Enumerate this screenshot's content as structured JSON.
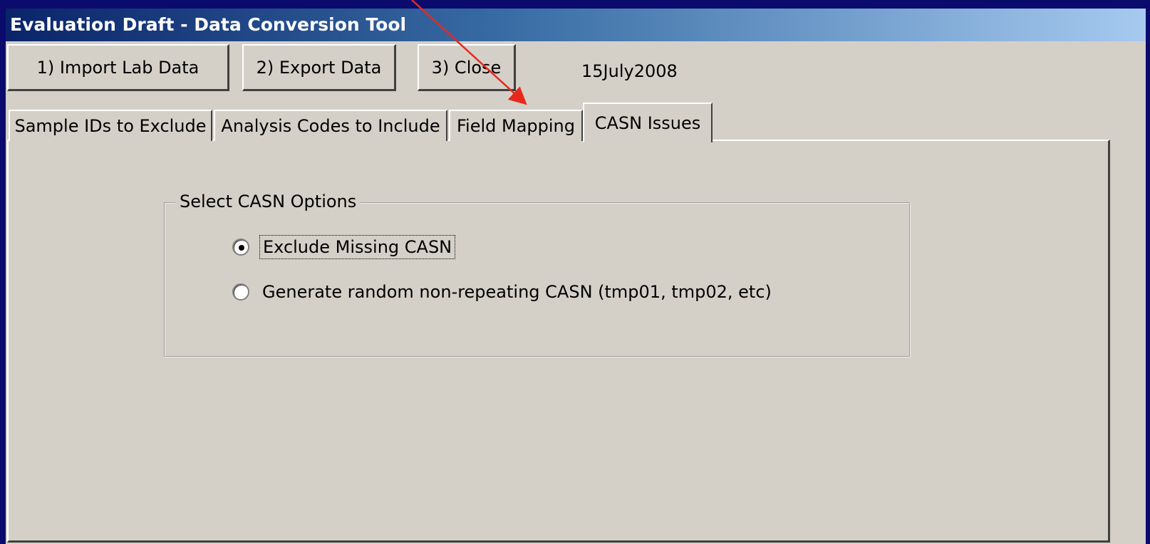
{
  "window": {
    "title": "Evaluation Draft - Data Conversion Tool"
  },
  "toolbar": {
    "import_label": "1) Import Lab Data",
    "export_label": "2) Export Data",
    "close_label": "3) Close",
    "date_text": "15July2008"
  },
  "tabs": [
    {
      "label": "Sample IDs to Exclude",
      "selected": false
    },
    {
      "label": "Analysis Codes to Include",
      "selected": false
    },
    {
      "label": "Field Mapping",
      "selected": false
    },
    {
      "label": "CASN Issues",
      "selected": true
    }
  ],
  "casn_panel": {
    "group_label": "Select CASN Options",
    "options": [
      {
        "label": "Exclude Missing CASN",
        "selected": true
      },
      {
        "label": "Generate random non-repeating CASN (tmp01, tmp02, etc)",
        "selected": false
      }
    ]
  },
  "colors": {
    "background": "#0b0b6e",
    "window_face": "#d4d0c8",
    "titlebar_start": "#0a246a",
    "titlebar_end": "#a6caf0",
    "annotation_arrow": "#e8281e"
  }
}
